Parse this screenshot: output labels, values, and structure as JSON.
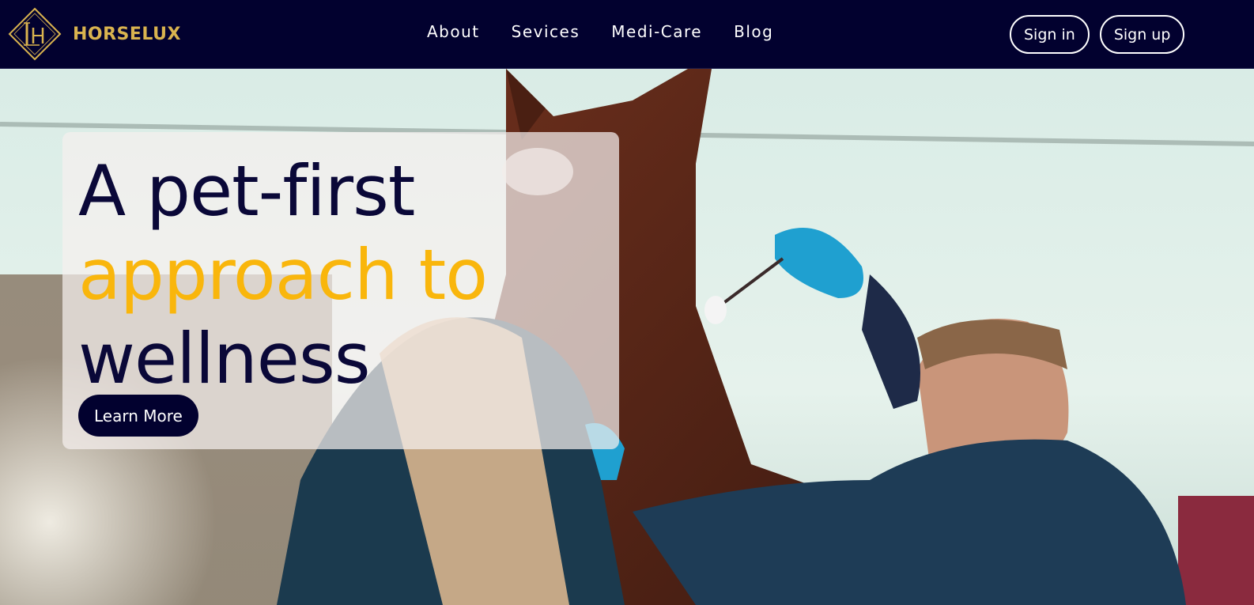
{
  "brand": {
    "name": "HORSELUX",
    "logo_icon": "hl-monogram-diamond-icon",
    "color": "#d9b34f"
  },
  "nav": {
    "links": [
      {
        "label": "About"
      },
      {
        "label": "Sevices"
      },
      {
        "label": "Medi-Care"
      },
      {
        "label": "Blog"
      }
    ]
  },
  "auth": {
    "sign_in": "Sign in",
    "sign_up": "Sign up"
  },
  "hero": {
    "headline_line1": "A pet-first",
    "headline_line2": "approach to",
    "headline_line3": "wellness",
    "cta_label": "Learn More",
    "accent_color": "#f9b60c",
    "dark_color": "#02012f",
    "image": "vets-examining-horse-photo"
  }
}
